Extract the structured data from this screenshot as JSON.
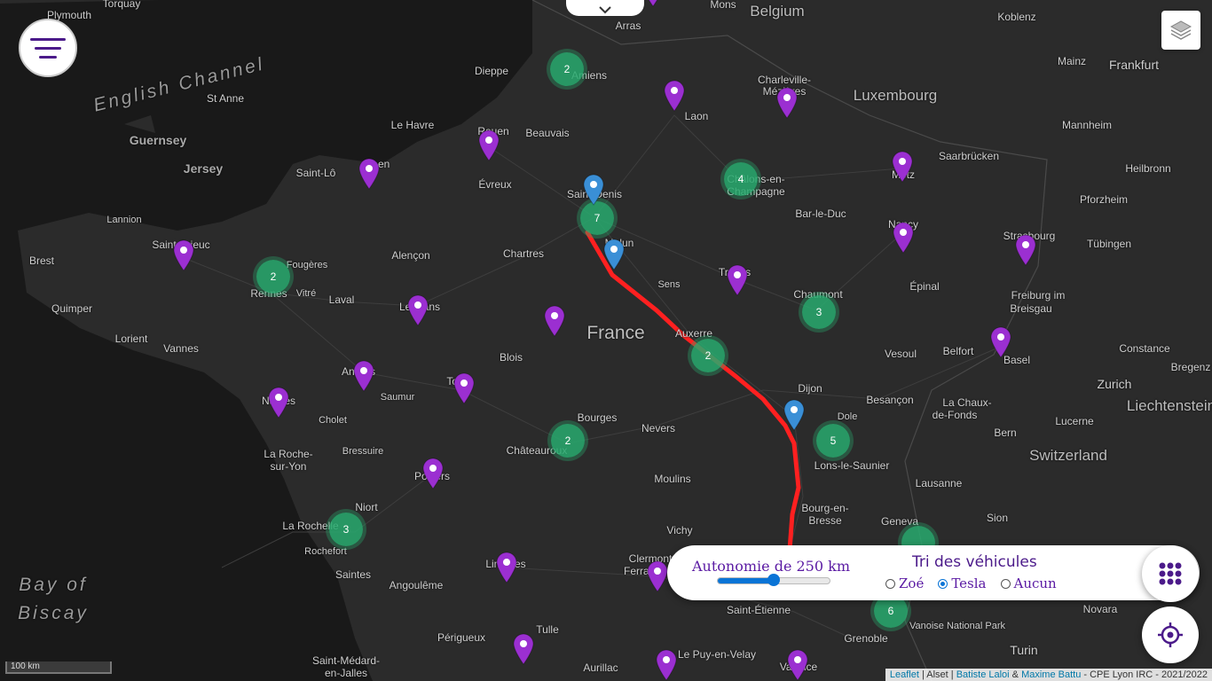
{
  "map": {
    "labels": {
      "plymouth": "Plymouth",
      "torquay": "Torquay",
      "english_channel": "English Channel",
      "guernsey": "Guernsey",
      "jersey": "Jersey",
      "st_anne": "St Anne",
      "bay_of_biscay_1": "Bay of",
      "bay_of_biscay_2": "Biscay",
      "belgium": "Belgium",
      "luxembourg": "Luxembourg",
      "switzerland": "Switzerland",
      "liechtenstein": "Liechtenstein",
      "france": "France",
      "koblenz": "Koblenz",
      "mons": "Mons",
      "arras": "Arras",
      "mainz": "Mainz",
      "frankfurt": "Frankfurt",
      "mannheim": "Mannheim",
      "saarbrucken": "Saarbrücken",
      "heilbronn": "Heilbronn",
      "pforzheim": "Pforzheim",
      "tubingen": "Tübingen",
      "strasbourg": "Strasbourg",
      "freiburg": "Freiburg im",
      "breisgau": "Breisgau",
      "basel": "Basel",
      "constance": "Constance",
      "zurich": "Zurich",
      "bregenz": "Bregenz",
      "lucerne": "Lucerne",
      "bern": "Bern",
      "lausanne": "Lausanne",
      "geneva": "Geneva",
      "sion": "Sion",
      "novara": "Novara",
      "turin": "Turin",
      "dieppe": "Dieppe",
      "amiens": "Amiens",
      "laon": "Laon",
      "charleville": "Charleville-",
      "mezieres": "Mézières",
      "le_havre": "Le Havre",
      "rouen": "Rouen",
      "beauvais": "Beauvais",
      "saint_lo": "Saint-Lô",
      "caen": "Caen",
      "evreux": "Évreux",
      "saint_denis": "Saint-Denis",
      "chalons": "Châlons-en-",
      "champagne": "Champagne",
      "metz": "Metz",
      "bar_le_duc": "Bar-le-Duc",
      "nancy": "Nancy",
      "lannion": "Lannion",
      "saint_brieuc": "Saint-Brieuc",
      "brest": "Brest",
      "fougeres": "Fougères",
      "rennes": "Rennes",
      "vitre": "Vitré",
      "alencon": "Alençon",
      "chartres": "Chartres",
      "melun": "Melun",
      "troyes": "Troyes",
      "sens": "Sens",
      "chaumont": "Chaumont",
      "epinal": "Épinal",
      "quimper": "Quimper",
      "laval": "Laval",
      "le_mans": "Le Mans",
      "lorient": "Lorient",
      "vannes": "Vannes",
      "blois": "Blois",
      "auxerre": "Auxerre",
      "vesoul": "Vesoul",
      "belfort": "Belfort",
      "angers": "Angers",
      "saumur": "Saumur",
      "tours": "Tours",
      "nantes": "Nantes",
      "cholet": "Cholet",
      "dijon": "Dijon",
      "besancon": "Besançon",
      "dole": "Dole",
      "la_chaux": "La Chaux-",
      "de_fonds": "de-Fonds",
      "bourges": "Bourges",
      "nevers": "Nevers",
      "chateauroux": "Châteauroux",
      "lons": "Lons-le-Saunier",
      "bressuire": "Bressuire",
      "la_roche": "La Roche-",
      "sur_yon": "sur-Yon",
      "poitiers": "Poitiers",
      "moulins": "Moulins",
      "bourg": "Bourg-en-",
      "bresse": "Bresse",
      "niort": "Niort",
      "la_rochelle": "La Rochelle",
      "rochefort": "Rochefort",
      "vichy": "Vichy",
      "saintes": "Saintes",
      "angouleme": "Angoulême",
      "limoges": "Limoges",
      "clermont": "Clermont-",
      "ferrand": "Ferrand",
      "saint_etienne": "Saint-Étienne",
      "grenoble": "Grenoble",
      "vanoise": "Vanoise National Park",
      "perigueux": "Périgueux",
      "tulle": "Tulle",
      "aurillac": "Aurillac",
      "le_puy": "Le Puy-en-Velay",
      "valence": "Valence",
      "saint_medard": "Saint-Médard-",
      "en_jalles": "en-Jalles"
    },
    "clusters": [
      "2",
      "4",
      "7",
      "2",
      "3",
      "2",
      "5",
      "2",
      "3",
      "6"
    ],
    "route_color": "#ff2020",
    "pin_color_purple": "#9b2fd1",
    "pin_color_blue": "#3a8fd6",
    "cluster_color": "#28aa6e"
  },
  "controls": {
    "autonomy_label": "Autonomie de 250 km",
    "autonomy_value_fraction": 0.5,
    "sort_title": "Tri des véhicules",
    "options": [
      "Zoé",
      "Tesla",
      "Aucun"
    ],
    "selected": "Tesla"
  },
  "scale": "100 km",
  "attribution": {
    "leaflet": "Leaflet",
    "sep1": " | Alset | ",
    "author1": "Batiste Laloi",
    "amp": " & ",
    "author2": "Maxime Battu",
    "rest": " - CPE Lyon IRC - 2021/2022"
  },
  "icons": {
    "menu": "menu-icon",
    "chevron": "chevron-down-icon",
    "layers": "layers-icon",
    "grid": "grid-icon",
    "locate": "locate-icon"
  }
}
